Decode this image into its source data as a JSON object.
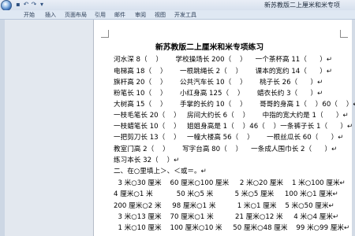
{
  "window": {
    "document_title": "新苏教版二上厘米和米专项"
  },
  "quick_access": {
    "save_icon": "save-icon",
    "undo_icon": "undo-icon",
    "redo_icon": "redo-icon",
    "dropdown_icon": "dropdown-icon"
  },
  "ribbon": {
    "tabs": [
      "开始",
      "插入",
      "页面布局",
      "引用",
      "邮件",
      "审阅",
      "视图",
      "开发工具"
    ]
  },
  "document": {
    "title": "新苏教版二上厘米和米专项练习",
    "lines": [
      "河水深 8（    ）      学校操场长 200（    ）    一个茶杯高 11（      ）↵",
      "电梯高 18（    ）      一根跳绳长 2（    ）      课本的宽约 14（      ）↵",
      "旗杆高 20（    ）      公共汽车长 10（    ）      桃子长 26（      ）↵",
      "粉笔长 10（    ）      小红身高 125（    ）      蜡衣长约 3（      ）↵",
      "大树高 15（    ）      手掌的长约 10（    ）      哥哥的身高 1（    ）60（    ）↵",
      "一枝毛笔长 20（    ）   房间大约长 6（    ）      中指的宽大约是 1（      ）↵",
      "一枝蜡笔长 10（    ）   姐姐身高是 1（    ）46（    ）一条裤子长 1（      ）↵",
      "一把剪刀长 13（    ）   一幢大楼高 56（    ）      一根丝瓜长 60（      ）↵",
      "教室门高 2（    ）      写字台高 80（    ）    一条成人围巾长 2（      ）↵",
      "练习本长 32（    ）↵",
      "二、在○里填上＞、＜或＝。↵",
      "  3 米○30 厘米    60 厘米○100 厘米     2 米○20 厘米    1 米○100 厘米↵",
      "4 厘米○1 米           50 米○5 米          5 米○5 厘米     100 米○1 厘米↵",
      "200 厘米○2 米     98 厘米○1 米          1 米○1 厘米    5 米○50 厘米↵",
      "  3 米○13 厘米    70 厘米○1 米          21 厘米○12 米     4 米○4 厘米↵",
      "  1 米○10 厘米    100 厘米○10 米     50 厘米○48 厘米    99 米○99 厘米↵"
    ]
  }
}
